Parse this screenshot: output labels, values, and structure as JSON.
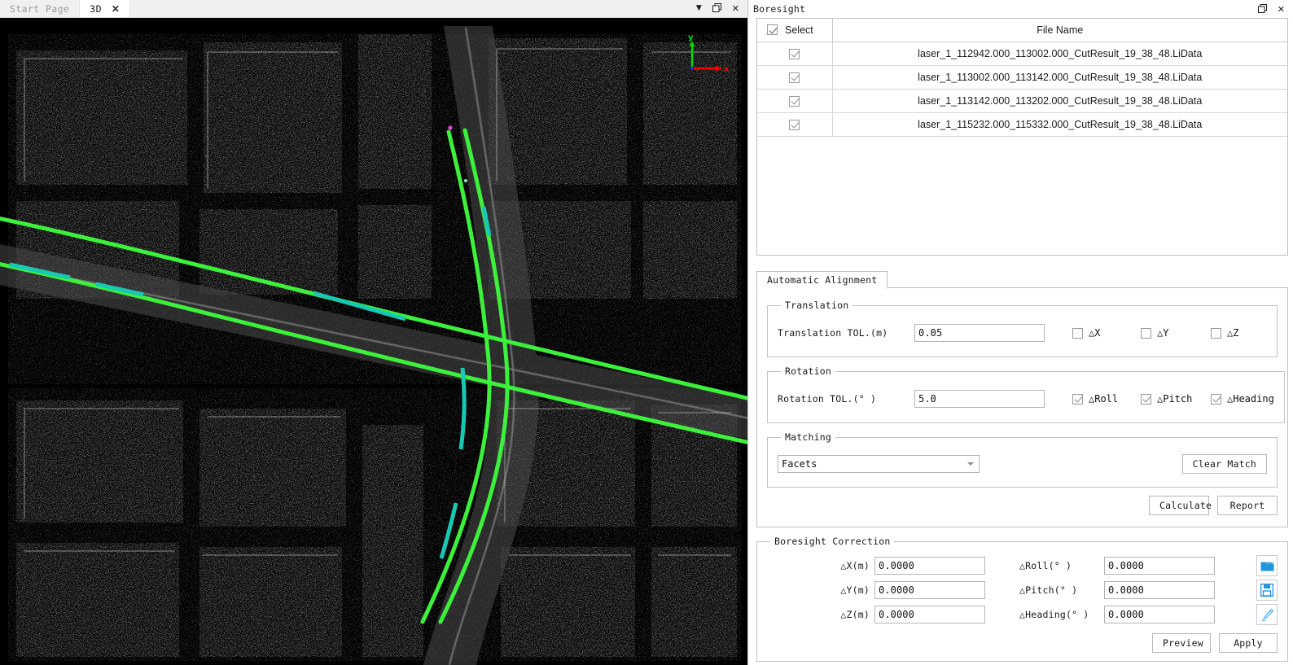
{
  "window": {
    "left_tabs": [
      {
        "label": "Start Page",
        "active": false,
        "closable": false
      },
      {
        "label": "3D",
        "active": true,
        "closable": true,
        "close_glyph": "✕"
      }
    ],
    "left_controls": [
      {
        "name": "tab-list-dropdown",
        "glyph": "▼"
      },
      {
        "name": "restore-window",
        "glyph": "❐"
      },
      {
        "name": "close-view",
        "glyph": "✕"
      }
    ],
    "panel_title": "Boresight",
    "panel_controls": [
      {
        "name": "restore-panel",
        "glyph": "❐"
      },
      {
        "name": "close-panel",
        "glyph": "✕"
      }
    ]
  },
  "viewport": {
    "background_color": "#000000",
    "trajectory_color": "#3cf03c",
    "trajectory_alt_color": "#18c8b4",
    "axis": {
      "x_label": "x",
      "x_color": "#ff0000",
      "y_label": "y",
      "y_color": "#00dd00"
    }
  },
  "file_table": {
    "headers": {
      "select": "Select",
      "file_name": "File Name"
    },
    "header_select_all_checked": true,
    "rows": [
      {
        "checked": true,
        "file_name": "laser_1_112942.000_113002.000_CutResult_19_38_48.LiData"
      },
      {
        "checked": true,
        "file_name": "laser_1_113002.000_113142.000_CutResult_19_38_48.LiData"
      },
      {
        "checked": true,
        "file_name": "laser_1_113142.000_113202.000_CutResult_19_38_48.LiData"
      },
      {
        "checked": true,
        "file_name": "laser_1_115232.000_115332.000_CutResult_19_38_48.LiData"
      }
    ]
  },
  "alignment_tab": {
    "label": "Automatic Alignment"
  },
  "translation": {
    "legend": "Translation",
    "tol_label": "Translation TOL.(m)",
    "tol_value": "0.05",
    "axes": [
      {
        "label": "△X",
        "checked": false
      },
      {
        "label": "△Y",
        "checked": false
      },
      {
        "label": "△Z",
        "checked": false
      }
    ]
  },
  "rotation": {
    "legend": "Rotation",
    "tol_label": "Rotation TOL.(° )",
    "tol_value": "5.0",
    "axes": [
      {
        "label": "△Roll",
        "checked": true
      },
      {
        "label": "△Pitch",
        "checked": true
      },
      {
        "label": "△Heading",
        "checked": true
      }
    ]
  },
  "matching": {
    "legend": "Matching",
    "selected_option": "Facets",
    "clear_match_label": "Clear Match"
  },
  "actions": {
    "calculate_label": "Calculate",
    "report_label": "Report"
  },
  "boresight_correction": {
    "legend": "Boresight Correction",
    "fields_left": [
      {
        "label": "△X(m)",
        "value": "0.0000"
      },
      {
        "label": "△Y(m)",
        "value": "0.0000"
      },
      {
        "label": "△Z(m)",
        "value": "0.0000"
      }
    ],
    "fields_right": [
      {
        "label": "△Roll(° )",
        "value": "0.0000"
      },
      {
        "label": "△Pitch(° )",
        "value": "0.0000"
      },
      {
        "label": "△Heading(° )",
        "value": "0.0000"
      }
    ],
    "icon_buttons": [
      {
        "name": "open-folder-icon",
        "color": "#2196d9"
      },
      {
        "name": "save-disk-icon",
        "color": "#2196d9"
      },
      {
        "name": "brush-reset-icon",
        "color": "#65bdee"
      }
    ],
    "preview_label": "Preview",
    "apply_label": "Apply"
  }
}
